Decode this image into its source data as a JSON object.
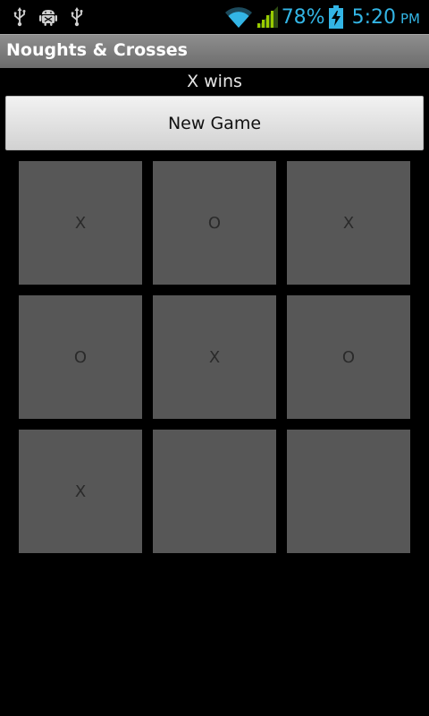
{
  "status_bar": {
    "left_icons": [
      "usb-icon",
      "android-debug-icon",
      "usb-icon"
    ],
    "wifi_icon": "wifi-icon",
    "signal_icon": "signal-icon",
    "battery_percent": "78%",
    "battery_icon": "battery-charging-icon",
    "time": "5:20",
    "ampm": "PM",
    "accent_color": "#33b5e5"
  },
  "app": {
    "title": "Noughts & Crosses"
  },
  "game": {
    "result": "X wins",
    "new_game_label": "New Game",
    "board": [
      [
        "X",
        "O",
        "X"
      ],
      [
        "O",
        "X",
        "O"
      ],
      [
        "X",
        "",
        ""
      ]
    ]
  }
}
